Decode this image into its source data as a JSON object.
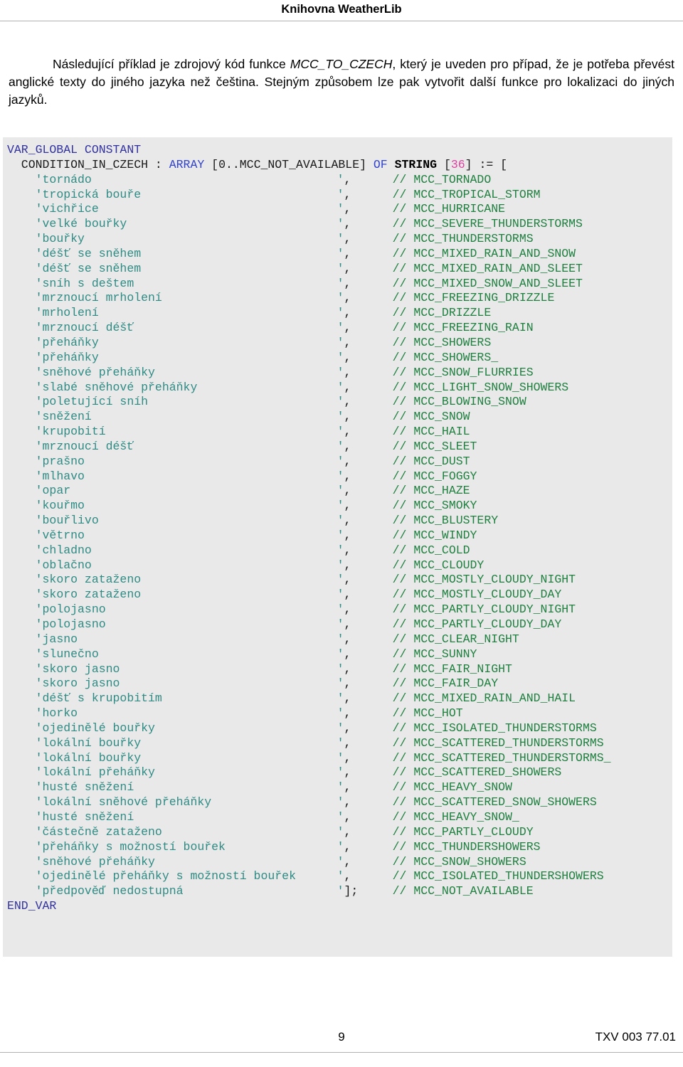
{
  "header": {
    "running_title": "Knihovna WeatherLib"
  },
  "intro": {
    "part1": "Následující příklad je zdrojový kód funkce ",
    "emphasis": "MCC_TO_CZECH",
    "part2": ", který je uveden pro případ, že je potřeba převést anglické texty do jiného jazyka než čeština. Stejným způsobem lze pak vytvořit další funkce pro lokalizaci do jiných jazyků."
  },
  "code": {
    "language": "IEC 61131-3 Structured Text",
    "colors": {
      "keyword": "#3333a0",
      "type_keyword": "#3344cc",
      "number": "#e040a0",
      "string": "#2e8b84",
      "comment": "#1f8040",
      "plain": "#1a1a1a",
      "background": "#e9e9e9"
    },
    "header_lines": [
      {
        "tokens": [
          {
            "t": "VAR_GLOBAL CONSTANT",
            "c": "kw"
          }
        ]
      },
      {
        "tokens": [
          {
            "t": "  CONDITION_IN_CZECH : ",
            "c": "plain"
          },
          {
            "t": "ARRAY",
            "c": "kw2"
          },
          {
            "t": " [0..MCC_NOT_AVAILABLE] ",
            "c": "plain"
          },
          {
            "t": "OF",
            "c": "kw2"
          },
          {
            "t": " ",
            "c": "plain"
          },
          {
            "t": "STRING",
            "c": "bold"
          },
          {
            "t": " [",
            "c": "plain"
          },
          {
            "t": "36",
            "c": "num"
          },
          {
            "t": "] := [",
            "c": "plain"
          }
        ]
      }
    ],
    "array_indent": "    ",
    "array_rows": [
      {
        "value": "'tornádo",
        "sep": "',",
        "comment": "// MCC_TORNADO"
      },
      {
        "value": "'tropická bouře",
        "sep": "',",
        "comment": "// MCC_TROPICAL_STORM"
      },
      {
        "value": "'vichřice",
        "sep": "',",
        "comment": "// MCC_HURRICANE"
      },
      {
        "value": "'velké bouřky",
        "sep": "',",
        "comment": "// MCC_SEVERE_THUNDERSTORMS"
      },
      {
        "value": "'bouřky",
        "sep": "',",
        "comment": "// MCC_THUNDERSTORMS"
      },
      {
        "value": "'déšť se sněhem",
        "sep": "',",
        "comment": "// MCC_MIXED_RAIN_AND_SNOW"
      },
      {
        "value": "'déšť se sněhem",
        "sep": "',",
        "comment": "// MCC_MIXED_RAIN_AND_SLEET"
      },
      {
        "value": "'sníh s deštem",
        "sep": "',",
        "comment": "// MCC_MIXED_SNOW_AND_SLEET"
      },
      {
        "value": "'mrznoucí mrholení",
        "sep": "',",
        "comment": "// MCC_FREEZING_DRIZZLE"
      },
      {
        "value": "'mrholení",
        "sep": "',",
        "comment": "// MCC_DRIZZLE"
      },
      {
        "value": "'mrznoucí déšť",
        "sep": "',",
        "comment": "// MCC_FREEZING_RAIN"
      },
      {
        "value": "'přeháňky",
        "sep": "',",
        "comment": "// MCC_SHOWERS"
      },
      {
        "value": "'přeháňky",
        "sep": "',",
        "comment": "// MCC_SHOWERS_"
      },
      {
        "value": "'sněhové přeháňky",
        "sep": "',",
        "comment": "// MCC_SNOW_FLURRIES"
      },
      {
        "value": "'slabé sněhové přeháňky",
        "sep": "',",
        "comment": "// MCC_LIGHT_SNOW_SHOWERS"
      },
      {
        "value": "'poletující sníh",
        "sep": "',",
        "comment": "// MCC_BLOWING_SNOW"
      },
      {
        "value": "'sněžení",
        "sep": "',",
        "comment": "// MCC_SNOW"
      },
      {
        "value": "'krupobití",
        "sep": "',",
        "comment": "// MCC_HAIL"
      },
      {
        "value": "'mrznoucí déšť",
        "sep": "',",
        "comment": "// MCC_SLEET"
      },
      {
        "value": "'prašno",
        "sep": "',",
        "comment": "// MCC_DUST"
      },
      {
        "value": "'mlhavo",
        "sep": "',",
        "comment": "// MCC_FOGGY"
      },
      {
        "value": "'opar",
        "sep": "',",
        "comment": "// MCC_HAZE"
      },
      {
        "value": "'kouřmo",
        "sep": "',",
        "comment": "// MCC_SMOKY"
      },
      {
        "value": "'bouřlivo",
        "sep": "',",
        "comment": "// MCC_BLUSTERY"
      },
      {
        "value": "'větrno",
        "sep": "',",
        "comment": "// MCC_WINDY"
      },
      {
        "value": "'chladno",
        "sep": "',",
        "comment": "// MCC_COLD"
      },
      {
        "value": "'oblačno",
        "sep": "',",
        "comment": "// MCC_CLOUDY"
      },
      {
        "value": "'skoro zataženo",
        "sep": "',",
        "comment": "// MCC_MOSTLY_CLOUDY_NIGHT"
      },
      {
        "value": "'skoro zataženo",
        "sep": "',",
        "comment": "// MCC_MOSTLY_CLOUDY_DAY"
      },
      {
        "value": "'polojasno",
        "sep": "',",
        "comment": "// MCC_PARTLY_CLOUDY_NIGHT"
      },
      {
        "value": "'polojasno",
        "sep": "',",
        "comment": "// MCC_PARTLY_CLOUDY_DAY"
      },
      {
        "value": "'jasno",
        "sep": "',",
        "comment": "// MCC_CLEAR_NIGHT"
      },
      {
        "value": "'slunečno",
        "sep": "',",
        "comment": "// MCC_SUNNY"
      },
      {
        "value": "'skoro jasno",
        "sep": "',",
        "comment": "// MCC_FAIR_NIGHT"
      },
      {
        "value": "'skoro jasno",
        "sep": "',",
        "comment": "// MCC_FAIR_DAY"
      },
      {
        "value": "'déšť s krupobitím",
        "sep": "',",
        "comment": "// MCC_MIXED_RAIN_AND_HAIL"
      },
      {
        "value": "'horko",
        "sep": "',",
        "comment": "// MCC_HOT"
      },
      {
        "value": "'ojedinělé bouřky",
        "sep": "',",
        "comment": "// MCC_ISOLATED_THUNDERSTORMS"
      },
      {
        "value": "'lokální bouřky",
        "sep": "',",
        "comment": "// MCC_SCATTERED_THUNDERSTORMS"
      },
      {
        "value": "'lokální bouřky",
        "sep": "',",
        "comment": "// MCC_SCATTERED_THUNDERSTORMS_"
      },
      {
        "value": "'lokální přeháňky",
        "sep": "',",
        "comment": "// MCC_SCATTERED_SHOWERS"
      },
      {
        "value": "'husté sněžení",
        "sep": "',",
        "comment": "// MCC_HEAVY_SNOW"
      },
      {
        "value": "'lokální sněhové přeháňky",
        "sep": "',",
        "comment": "// MCC_SCATTERED_SNOW_SHOWERS"
      },
      {
        "value": "'husté sněžení",
        "sep": "',",
        "comment": "// MCC_HEAVY_SNOW_"
      },
      {
        "value": "'částečně zataženo",
        "sep": "',",
        "comment": "// MCC_PARTLY_CLOUDY"
      },
      {
        "value": "'přeháňky s možností bouřek",
        "sep": "',",
        "comment": "// MCC_THUNDERSHOWERS"
      },
      {
        "value": "'sněhové přeháňky",
        "sep": "',",
        "comment": "// MCC_SNOW_SHOWERS"
      },
      {
        "value": "'ojedinělé přeháňky s možností bouřek",
        "sep": "',",
        "comment": "// MCC_ISOLATED_THUNDERSHOWERS"
      },
      {
        "value": "'předpověď nedostupná",
        "sep": "'];",
        "comment": "// MCC_NOT_AVAILABLE"
      }
    ],
    "footer_lines": [
      {
        "tokens": [
          {
            "t": "END_VAR",
            "c": "kw"
          }
        ]
      }
    ]
  },
  "footer": {
    "page_number": "9",
    "document_code": "TXV 003 77.01"
  }
}
